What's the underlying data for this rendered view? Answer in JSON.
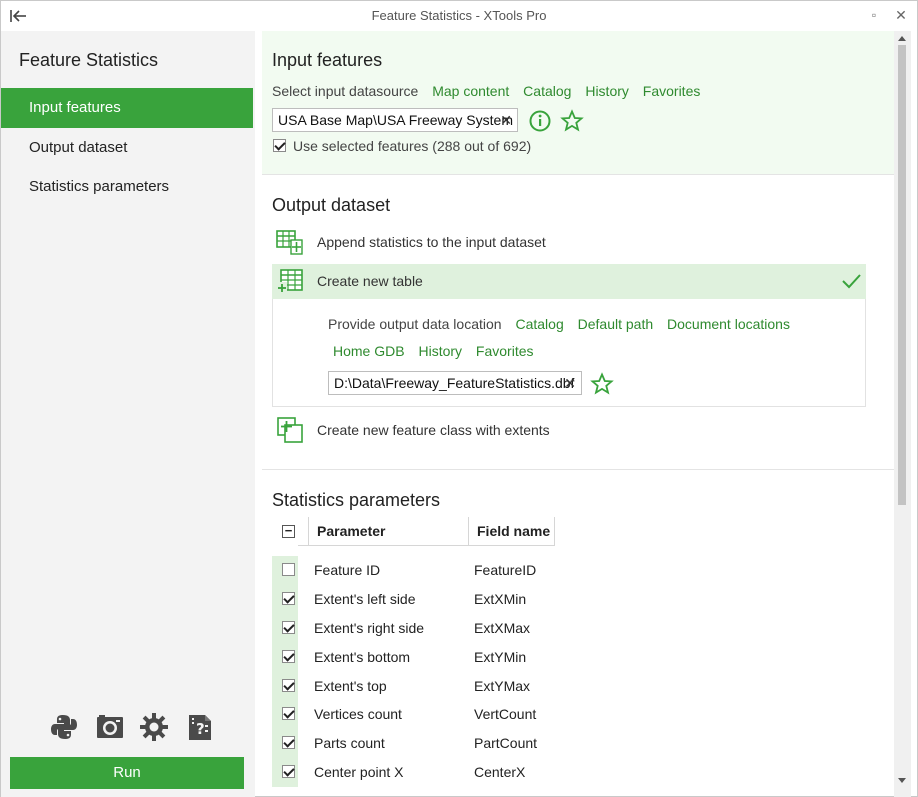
{
  "window": {
    "title": "Feature Statistics - XTools Pro",
    "back_glyph": "⇤",
    "maximize_glyph": "▫",
    "close_glyph": "✕"
  },
  "sidebar": {
    "title": "Feature Statistics",
    "items": [
      {
        "label": "Input features",
        "active": true
      },
      {
        "label": "Output dataset",
        "active": false
      },
      {
        "label": "Statistics parameters",
        "active": false
      }
    ],
    "tool_icons": [
      "python-icon",
      "camera-icon",
      "gear-icon",
      "help-icon"
    ],
    "run_label": "Run",
    "accent_color": "#39a33c"
  },
  "input_features": {
    "title": "Input features",
    "select_label": "Select input datasource",
    "links": [
      "Map content",
      "Catalog",
      "History",
      "Favorites"
    ],
    "datasource_value": "USA Base Map\\USA Freeway System",
    "clear_glyph": "✕",
    "use_selected_label": "Use selected features (288 out of 692)",
    "use_selected_checked": true
  },
  "output_dataset": {
    "title": "Output dataset",
    "options": [
      {
        "label": "Append statistics to the input dataset",
        "icon": "table-append-icon",
        "selected": false
      },
      {
        "label": "Create new table",
        "icon": "table-new-icon",
        "selected": true
      },
      {
        "label": "Create new feature class with extents",
        "icon": "feature-class-extents-icon",
        "selected": false
      }
    ],
    "check_glyph": "✓",
    "location_label": "Provide output data location",
    "location_links_row1": [
      "Catalog",
      "Default path",
      "Document locations"
    ],
    "location_links_row2": [
      "Home GDB",
      "History",
      "Favorites"
    ],
    "output_path": "D:\\Data\\Freeway_FeatureStatistics.dbf",
    "clear_glyph": "✕"
  },
  "statistics": {
    "title": "Statistics parameters",
    "header_toggle_glyph": "−",
    "columns": [
      "Parameter",
      "Field name"
    ],
    "rows": [
      {
        "parameter": "Feature ID",
        "field": "FeatureID",
        "checked": false
      },
      {
        "parameter": "Extent's left side",
        "field": "ExtXMin",
        "checked": true
      },
      {
        "parameter": "Extent's right side",
        "field": "ExtXMax",
        "checked": true
      },
      {
        "parameter": "Extent's bottom",
        "field": "ExtYMin",
        "checked": true
      },
      {
        "parameter": "Extent's top",
        "field": "ExtYMax",
        "checked": true
      },
      {
        "parameter": "Vertices count",
        "field": "VertCount",
        "checked": true
      },
      {
        "parameter": "Parts count",
        "field": "PartCount",
        "checked": true
      },
      {
        "parameter": "Center point X",
        "field": "CenterX",
        "checked": true
      }
    ]
  }
}
